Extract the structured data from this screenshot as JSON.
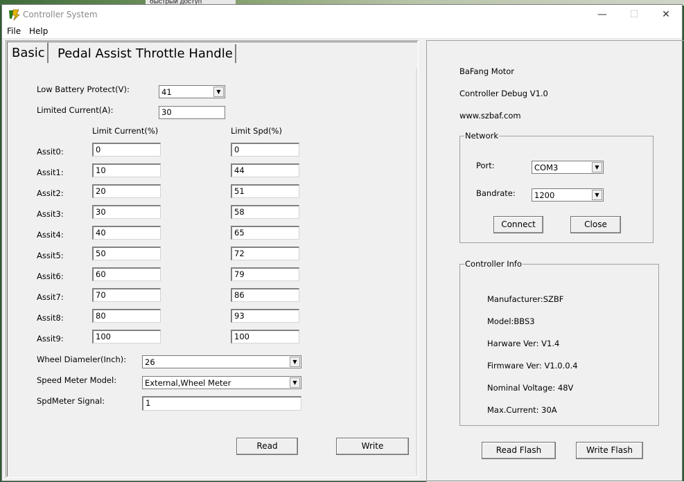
{
  "background": {
    "taskbar_text": "быстрый доступ"
  },
  "window": {
    "title": "Controller System",
    "controls": {
      "minimize": "—",
      "maximize": "☐",
      "close": "✕"
    }
  },
  "menu": {
    "items": [
      "File",
      "Help"
    ]
  },
  "tabs": [
    "Basic",
    "Pedal Assist",
    "Throttle Handle"
  ],
  "basic": {
    "low_battery_label": "Low Battery Protect(V):",
    "low_battery_value": "41",
    "limited_current_label": "Limited Current(A):",
    "limited_current_value": "30",
    "col_limit_current": "Limit Current(%)",
    "col_limit_spd": "Limit Spd(%)",
    "assists": [
      {
        "label": "Assit0:",
        "current": "0",
        "spd": "0"
      },
      {
        "label": "Assit1:",
        "current": "10",
        "spd": "44"
      },
      {
        "label": "Assit2:",
        "current": "20",
        "spd": "51"
      },
      {
        "label": "Assit3:",
        "current": "30",
        "spd": "58"
      },
      {
        "label": "Assit4:",
        "current": "40",
        "spd": "65"
      },
      {
        "label": "Assit5:",
        "current": "50",
        "spd": "72"
      },
      {
        "label": "Assit6:",
        "current": "60",
        "spd": "79"
      },
      {
        "label": "Assit7:",
        "current": "70",
        "spd": "86"
      },
      {
        "label": "Assit8:",
        "current": "80",
        "spd": "93"
      },
      {
        "label": "Assit9:",
        "current": "100",
        "spd": "100"
      }
    ],
    "wheel_diameter_label": "Wheel Diameler(Inch):",
    "wheel_diameter_value": "26",
    "speed_meter_label": "Speed Meter Model:",
    "speed_meter_value": "External,Wheel Meter",
    "spdmeter_signal_label": "SpdMeter Signal:",
    "spdmeter_signal_value": "1",
    "read_button": "Read",
    "write_button": "Write"
  },
  "info": {
    "brand": "BaFang Motor",
    "debug": "Controller Debug V1.0",
    "website": "www.szbaf.com"
  },
  "network": {
    "title": "Network",
    "port_label": "Port:",
    "port_value": "COM3",
    "baud_label": "Bandrate:",
    "baud_value": "1200",
    "connect_button": "Connect",
    "close_button": "Close"
  },
  "controller_info": {
    "title": "Controller Info",
    "manufacturer": "Manufacturer:SZBF",
    "model": "Model:BBS3",
    "hardware": "Harware Ver: V1.4",
    "firmware": "Firmware Ver: V1.0.0.4",
    "voltage": "Nominal Voltage: 48V",
    "current": "Max.Current: 30A"
  },
  "flash": {
    "read_button": "Read Flash",
    "write_button": "Write Flash"
  }
}
